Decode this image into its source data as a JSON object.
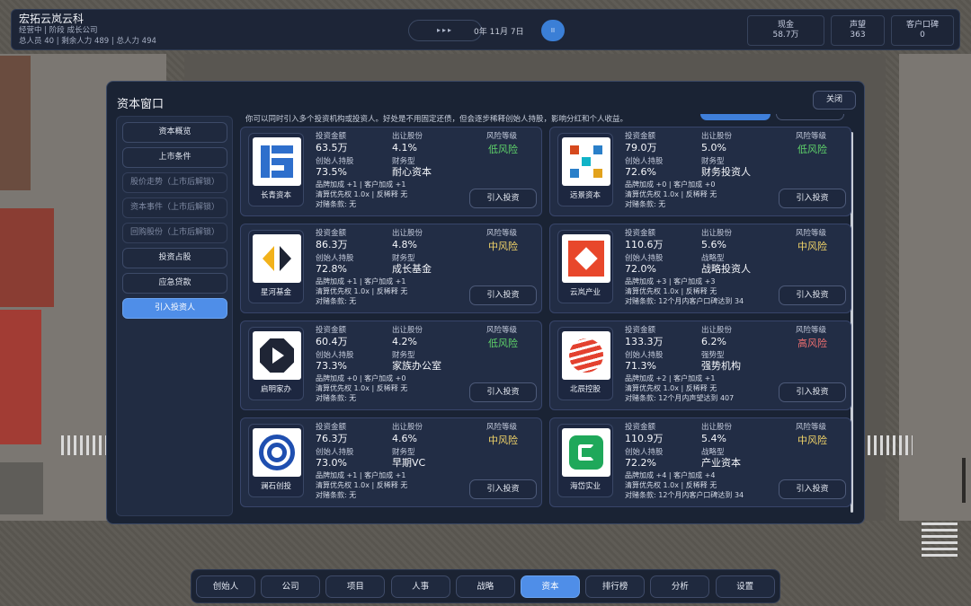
{
  "hud": {
    "company_name": "宏拓云岚云科",
    "status_line": "经营中 | 阶段 成长公司",
    "staff_line": "总人员 40 | 剩余人力 489 | 总人力 494",
    "speed_icon": "fast-forward-icon",
    "speed_glyph": "▸▸▸",
    "date": "0年 11月 7日",
    "pause_glyph": "II",
    "stats": [
      {
        "label": "现金",
        "value": "58.7万"
      },
      {
        "label": "声望",
        "value": "363"
      },
      {
        "label": "客户口碑",
        "value": "0"
      }
    ]
  },
  "window": {
    "title": "资本窗口",
    "close_label": "关闭",
    "notice": "你可以同时引入多个投资机构或投资人。好处是不用固定还债，但会逐步稀释创始人持股，影响分红和个人收益。",
    "sidebar": [
      {
        "label": "资本概览",
        "state": "normal"
      },
      {
        "label": "上市条件",
        "state": "normal"
      },
      {
        "label": "股价走势（上市后解锁）",
        "state": "disabled"
      },
      {
        "label": "资本事件（上市后解锁）",
        "state": "disabled"
      },
      {
        "label": "回购股份（上市后解锁）",
        "state": "disabled"
      },
      {
        "label": "投资占股",
        "state": "normal"
      },
      {
        "label": "应急贷款",
        "state": "normal"
      },
      {
        "label": "引入投资人",
        "state": "active"
      }
    ],
    "labels": {
      "invest": "投资金额",
      "equity": "出让股份",
      "risk": "风险等级",
      "founder": "创始人持股",
      "invest_button": "引入投资"
    },
    "colors": {
      "low": "#5fd36a",
      "mid": "#f2d469",
      "high": "#f07070",
      "accent": "#4f8ee8"
    },
    "investors": [
      {
        "name": "长青资本",
        "icon": "changqing-logo-icon",
        "amount": "63.5万",
        "equity": "4.1%",
        "risk": "低风险",
        "risk_level": "low",
        "founder_share": "73.5%",
        "type_label": "财务型",
        "type": "耐心资本",
        "bonus": "品牌加成 +1 | 客户加成 +1",
        "terms": "清算优先权 1.0x | 反稀释 无",
        "clause": "对赌条款: 无"
      },
      {
        "name": "远景资本",
        "icon": "yuanjing-logo-icon",
        "amount": "79.0万",
        "equity": "5.0%",
        "risk": "低风险",
        "risk_level": "low",
        "founder_share": "72.6%",
        "type_label": "财务型",
        "type": "财务投资人",
        "bonus": "品牌加成 +0 | 客户加成 +0",
        "terms": "清算优先权 1.0x | 反稀释 无",
        "clause": "对赌条款: 无"
      },
      {
        "name": "星河基金",
        "icon": "xinghe-logo-icon",
        "amount": "86.3万",
        "equity": "4.8%",
        "risk": "中风险",
        "risk_level": "mid",
        "founder_share": "72.8%",
        "type_label": "财务型",
        "type": "成长基金",
        "bonus": "品牌加成 +1 | 客户加成 +1",
        "terms": "清算优先权 1.0x | 反稀释 无",
        "clause": "对赌条款: 无"
      },
      {
        "name": "云岚产业",
        "icon": "yunlan-logo-icon",
        "amount": "110.6万",
        "equity": "5.6%",
        "risk": "中风险",
        "risk_level": "mid",
        "founder_share": "72.0%",
        "type_label": "战略型",
        "type": "战略投资人",
        "bonus": "品牌加成 +3 | 客户加成 +3",
        "terms": "清算优先权 1.0x | 反稀释 无",
        "clause": "对赌条款: 12个月内客户口碑达到 34"
      },
      {
        "name": "启明家办",
        "icon": "qiming-logo-icon",
        "amount": "60.4万",
        "equity": "4.2%",
        "risk": "低风险",
        "risk_level": "low",
        "founder_share": "73.3%",
        "type_label": "财务型",
        "type": "家族办公室",
        "bonus": "品牌加成 +0 | 客户加成 +0",
        "terms": "清算优先权 1.0x | 反稀释 无",
        "clause": "对赌条款: 无"
      },
      {
        "name": "北辰控股",
        "icon": "beichen-logo-icon",
        "amount": "133.3万",
        "equity": "6.2%",
        "risk": "高风险",
        "risk_level": "high",
        "founder_share": "71.3%",
        "type_label": "强势型",
        "type": "强势机构",
        "bonus": "品牌加成 +2 | 客户加成 +1",
        "terms": "清算优先权 1.0x | 反稀释 无",
        "clause": "对赌条款: 12个月内声望达到 407"
      },
      {
        "name": "澜石创投",
        "icon": "lanshi-logo-icon",
        "amount": "76.3万",
        "equity": "4.6%",
        "risk": "中风险",
        "risk_level": "mid",
        "founder_share": "73.0%",
        "type_label": "财务型",
        "type": "早期VC",
        "bonus": "品牌加成 +1 | 客户加成 +1",
        "terms": "清算优先权 1.0x | 反稀释 无",
        "clause": "对赌条款: 无"
      },
      {
        "name": "海岱实业",
        "icon": "haidai-logo-icon",
        "amount": "110.9万",
        "equity": "5.4%",
        "risk": "中风险",
        "risk_level": "mid",
        "founder_share": "72.2%",
        "type_label": "战略型",
        "type": "产业资本",
        "bonus": "品牌加成 +4 | 客户加成 +4",
        "terms": "清算优先权 1.0x | 反稀释 无",
        "clause": "对赌条款: 12个月内客户口碑达到 34"
      }
    ]
  },
  "nav": [
    {
      "label": "创始人",
      "active": false
    },
    {
      "label": "公司",
      "active": false
    },
    {
      "label": "项目",
      "active": false
    },
    {
      "label": "人事",
      "active": false
    },
    {
      "label": "战略",
      "active": false
    },
    {
      "label": "资本",
      "active": true
    },
    {
      "label": "排行榜",
      "active": false
    },
    {
      "label": "分析",
      "active": false
    },
    {
      "label": "设置",
      "active": false
    }
  ]
}
